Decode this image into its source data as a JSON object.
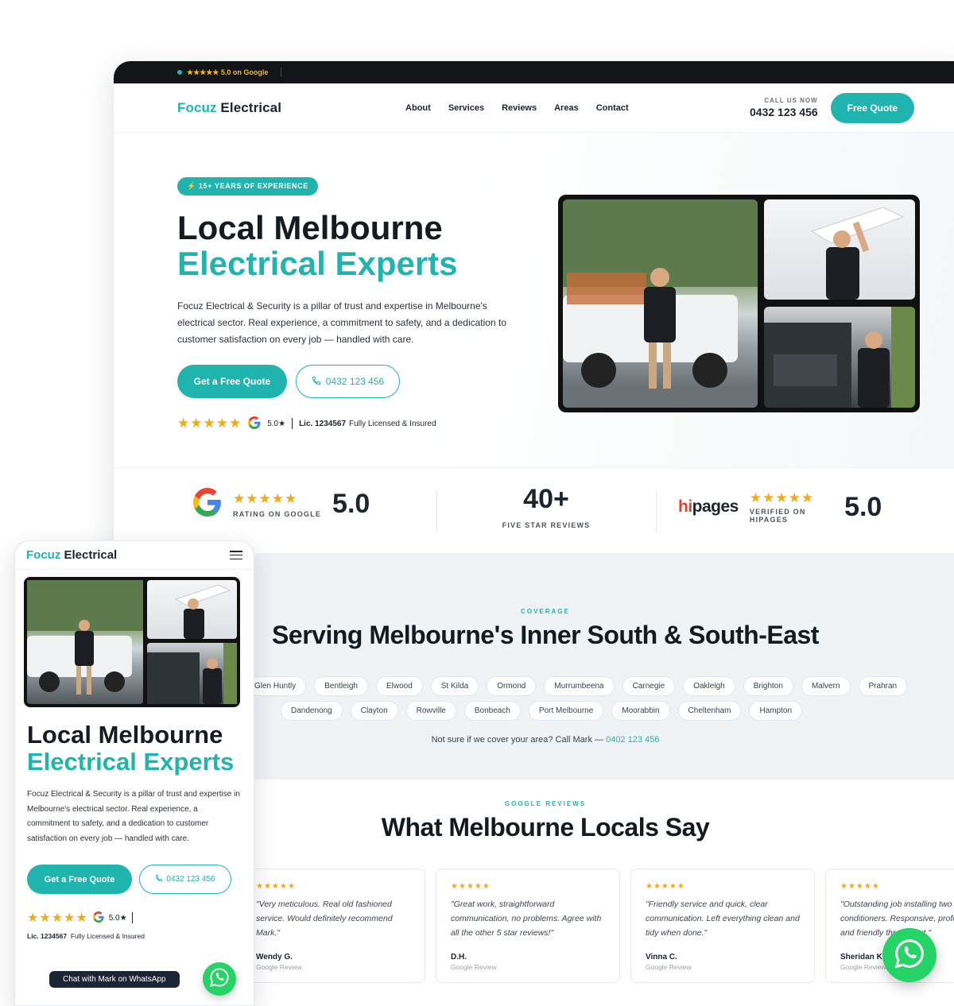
{
  "desktop": {
    "topbar": {
      "rating": "★★★★★ 5.0 on Google"
    },
    "nav": {
      "logo_brand": "Focuz",
      "logo_rest": " Electrical",
      "menu": [
        "About",
        "Services",
        "Reviews",
        "Areas",
        "Contact"
      ],
      "call_label": "CALL US NOW",
      "call_number": "0432 123 456",
      "cta": "Free Quote"
    },
    "hero": {
      "badge": "⚡ 15+ YEARS OF EXPERIENCE",
      "title_line1": "Local Melbourne",
      "title_line2": "Electrical Experts",
      "lead": "Focuz Electrical & Security is a pillar of trust and expertise in Melbourne's electrical sector. Real experience, a commitment to safety, and a dedication to customer satisfaction on every job — handled with care.",
      "btn_primary": "Get a Free Quote",
      "btn_phone": "0432 123 456",
      "trust_stars": "★★★★★",
      "trust_score": "5.0★",
      "licence": "Lic. 1234567",
      "licensed": "Fully Licensed & Insured"
    },
    "stats": {
      "google_stars": "★★★★★",
      "google_label": "RATING ON GOOGLE",
      "google_score": "5.0",
      "reviews_count": "40+",
      "reviews_label": "FIVE STAR REVIEWS",
      "hipages_logo_a": "hi",
      "hipages_logo_b": "pages",
      "hipages_stars": "★★★★★",
      "hipages_label_1": "VERIFIED ON",
      "hipages_label_2": "HIPAGES",
      "hipages_score": "5.0"
    },
    "coverage": {
      "kicker": "COVERAGE",
      "title": "Serving Melbourne's Inner South & South-East",
      "row1": [
        "Glen Huntly",
        "Bentleigh",
        "Elwood",
        "St Kilda",
        "Ormond",
        "Murrumbeena",
        "Carnegie",
        "Oakleigh",
        "Brighton",
        "Malvern",
        "Prahran"
      ],
      "row2": [
        "Dandenong",
        "Clayton",
        "Rowville",
        "Bonbeach",
        "Port Melbourne",
        "Moorabbin",
        "Cheltenham",
        "Hampton"
      ],
      "note": "Not sure if we cover your area? Call Mark — ",
      "note_phone": "0402 123 456"
    },
    "reviews": {
      "kicker": "GOOGLE REVIEWS",
      "title": "What Melbourne Locals Say",
      "items": [
        {
          "stars": "★★★★★",
          "quote": "\"Very meticulous. Real old fashioned service. Would definitely recommend Mark.\"",
          "name": "Wendy G.",
          "source": "Google Review"
        },
        {
          "stars": "★★★★★",
          "quote": "\"Great work, straightforward communication, no problems. Agree with all the other 5 star reviews!\"",
          "name": "D.H.",
          "source": "Google Review"
        },
        {
          "stars": "★★★★★",
          "quote": "\"Friendly service and quick, clear communication. Left everything clean and tidy when done.\"",
          "name": "Vinna C.",
          "source": "Google Review"
        },
        {
          "stars": "★★★★★",
          "quote": "\"Outstanding job installing two conditioners. Responsive, professional and friendly throughout.\"",
          "name": "Sheridan K.",
          "source": "Google Review"
        }
      ]
    }
  },
  "mobile": {
    "logo_brand": "Focuz",
    "logo_rest": " Electrical",
    "title_line1": "Local Melbourne",
    "title_line2": "Electrical Experts",
    "lead": "Focuz Electrical & Security is a pillar of trust and expertise in Melbourne's electrical sector. Real experience, a commitment to safety, and a dedication to customer satisfaction on every job — handled with care.",
    "btn_primary": "Get a Free Quote",
    "btn_phone": "0432 123 456",
    "trust_stars": "★★★★★",
    "trust_score": "5.0★",
    "licence": "Lic. 1234567",
    "licensed": "Fully Licensed & Insured",
    "whatsapp_tip": "Chat with Mark on WhatsApp"
  },
  "colors": {
    "accent": "#1fb5ae",
    "dark": "#121417",
    "star": "#f5a91a",
    "whatsapp": "#25d366"
  }
}
